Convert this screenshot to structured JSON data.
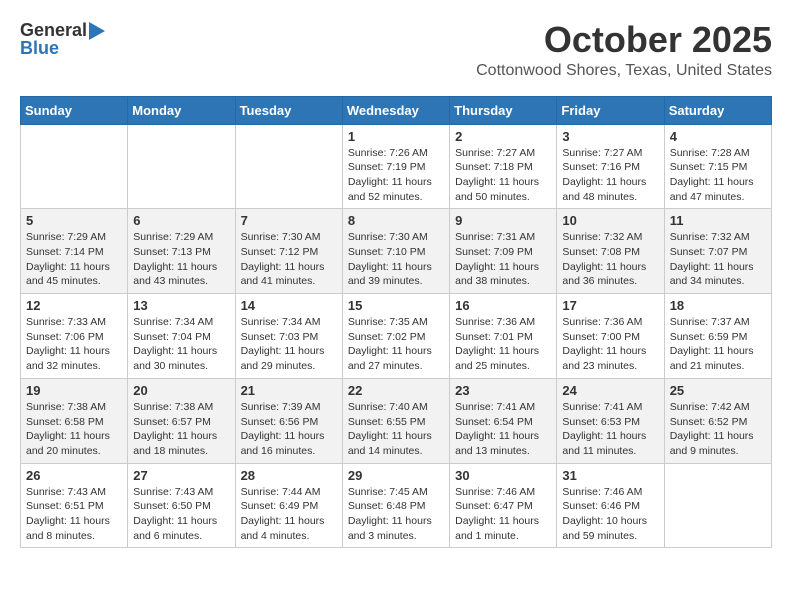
{
  "header": {
    "logo_general": "General",
    "logo_blue": "Blue",
    "month_title": "October 2025",
    "location": "Cottonwood Shores, Texas, United States"
  },
  "days_of_week": [
    "Sunday",
    "Monday",
    "Tuesday",
    "Wednesday",
    "Thursday",
    "Friday",
    "Saturday"
  ],
  "weeks": [
    [
      {
        "day": "",
        "info": ""
      },
      {
        "day": "",
        "info": ""
      },
      {
        "day": "",
        "info": ""
      },
      {
        "day": "1",
        "info": "Sunrise: 7:26 AM\nSunset: 7:19 PM\nDaylight: 11 hours\nand 52 minutes."
      },
      {
        "day": "2",
        "info": "Sunrise: 7:27 AM\nSunset: 7:18 PM\nDaylight: 11 hours\nand 50 minutes."
      },
      {
        "day": "3",
        "info": "Sunrise: 7:27 AM\nSunset: 7:16 PM\nDaylight: 11 hours\nand 48 minutes."
      },
      {
        "day": "4",
        "info": "Sunrise: 7:28 AM\nSunset: 7:15 PM\nDaylight: 11 hours\nand 47 minutes."
      }
    ],
    [
      {
        "day": "5",
        "info": "Sunrise: 7:29 AM\nSunset: 7:14 PM\nDaylight: 11 hours\nand 45 minutes."
      },
      {
        "day": "6",
        "info": "Sunrise: 7:29 AM\nSunset: 7:13 PM\nDaylight: 11 hours\nand 43 minutes."
      },
      {
        "day": "7",
        "info": "Sunrise: 7:30 AM\nSunset: 7:12 PM\nDaylight: 11 hours\nand 41 minutes."
      },
      {
        "day": "8",
        "info": "Sunrise: 7:30 AM\nSunset: 7:10 PM\nDaylight: 11 hours\nand 39 minutes."
      },
      {
        "day": "9",
        "info": "Sunrise: 7:31 AM\nSunset: 7:09 PM\nDaylight: 11 hours\nand 38 minutes."
      },
      {
        "day": "10",
        "info": "Sunrise: 7:32 AM\nSunset: 7:08 PM\nDaylight: 11 hours\nand 36 minutes."
      },
      {
        "day": "11",
        "info": "Sunrise: 7:32 AM\nSunset: 7:07 PM\nDaylight: 11 hours\nand 34 minutes."
      }
    ],
    [
      {
        "day": "12",
        "info": "Sunrise: 7:33 AM\nSunset: 7:06 PM\nDaylight: 11 hours\nand 32 minutes."
      },
      {
        "day": "13",
        "info": "Sunrise: 7:34 AM\nSunset: 7:04 PM\nDaylight: 11 hours\nand 30 minutes."
      },
      {
        "day": "14",
        "info": "Sunrise: 7:34 AM\nSunset: 7:03 PM\nDaylight: 11 hours\nand 29 minutes."
      },
      {
        "day": "15",
        "info": "Sunrise: 7:35 AM\nSunset: 7:02 PM\nDaylight: 11 hours\nand 27 minutes."
      },
      {
        "day": "16",
        "info": "Sunrise: 7:36 AM\nSunset: 7:01 PM\nDaylight: 11 hours\nand 25 minutes."
      },
      {
        "day": "17",
        "info": "Sunrise: 7:36 AM\nSunset: 7:00 PM\nDaylight: 11 hours\nand 23 minutes."
      },
      {
        "day": "18",
        "info": "Sunrise: 7:37 AM\nSunset: 6:59 PM\nDaylight: 11 hours\nand 21 minutes."
      }
    ],
    [
      {
        "day": "19",
        "info": "Sunrise: 7:38 AM\nSunset: 6:58 PM\nDaylight: 11 hours\nand 20 minutes."
      },
      {
        "day": "20",
        "info": "Sunrise: 7:38 AM\nSunset: 6:57 PM\nDaylight: 11 hours\nand 18 minutes."
      },
      {
        "day": "21",
        "info": "Sunrise: 7:39 AM\nSunset: 6:56 PM\nDaylight: 11 hours\nand 16 minutes."
      },
      {
        "day": "22",
        "info": "Sunrise: 7:40 AM\nSunset: 6:55 PM\nDaylight: 11 hours\nand 14 minutes."
      },
      {
        "day": "23",
        "info": "Sunrise: 7:41 AM\nSunset: 6:54 PM\nDaylight: 11 hours\nand 13 minutes."
      },
      {
        "day": "24",
        "info": "Sunrise: 7:41 AM\nSunset: 6:53 PM\nDaylight: 11 hours\nand 11 minutes."
      },
      {
        "day": "25",
        "info": "Sunrise: 7:42 AM\nSunset: 6:52 PM\nDaylight: 11 hours\nand 9 minutes."
      }
    ],
    [
      {
        "day": "26",
        "info": "Sunrise: 7:43 AM\nSunset: 6:51 PM\nDaylight: 11 hours\nand 8 minutes."
      },
      {
        "day": "27",
        "info": "Sunrise: 7:43 AM\nSunset: 6:50 PM\nDaylight: 11 hours\nand 6 minutes."
      },
      {
        "day": "28",
        "info": "Sunrise: 7:44 AM\nSunset: 6:49 PM\nDaylight: 11 hours\nand 4 minutes."
      },
      {
        "day": "29",
        "info": "Sunrise: 7:45 AM\nSunset: 6:48 PM\nDaylight: 11 hours\nand 3 minutes."
      },
      {
        "day": "30",
        "info": "Sunrise: 7:46 AM\nSunset: 6:47 PM\nDaylight: 11 hours\nand 1 minute."
      },
      {
        "day": "31",
        "info": "Sunrise: 7:46 AM\nSunset: 6:46 PM\nDaylight: 10 hours\nand 59 minutes."
      },
      {
        "day": "",
        "info": ""
      }
    ]
  ]
}
